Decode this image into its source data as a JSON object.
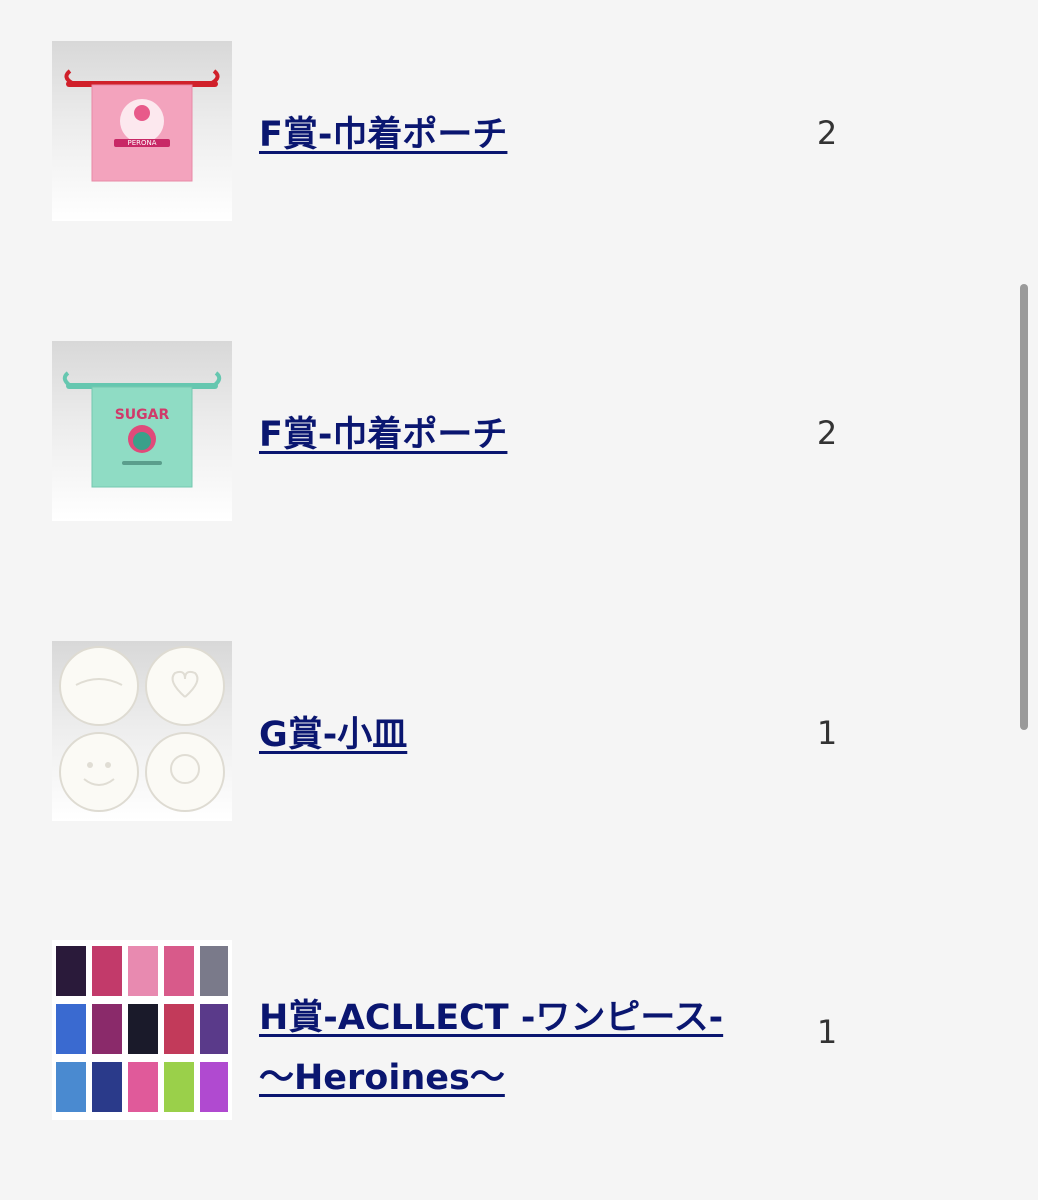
{
  "items": [
    {
      "title": "F賞-巾着ポーチ",
      "quantity": "2",
      "image_icon": "pink-drawstring-pouch-image",
      "image_text": "PERONA"
    },
    {
      "title": "F賞-巾着ポーチ",
      "quantity": "2",
      "image_icon": "mint-drawstring-pouch-image",
      "image_text": "SUGAR"
    },
    {
      "title": "G賞-小皿",
      "quantity": "1",
      "image_icon": "small-plates-image"
    },
    {
      "title": "H賞-ACLLECT -ワンピース- 〜Heroines〜",
      "quantity": "1",
      "image_icon": "acrylic-cards-image"
    }
  ],
  "colors": {
    "background": "#f5f5f5",
    "link": "#0a1670",
    "quantity_text": "#333333",
    "scrollbar": "#9a9a9a"
  }
}
